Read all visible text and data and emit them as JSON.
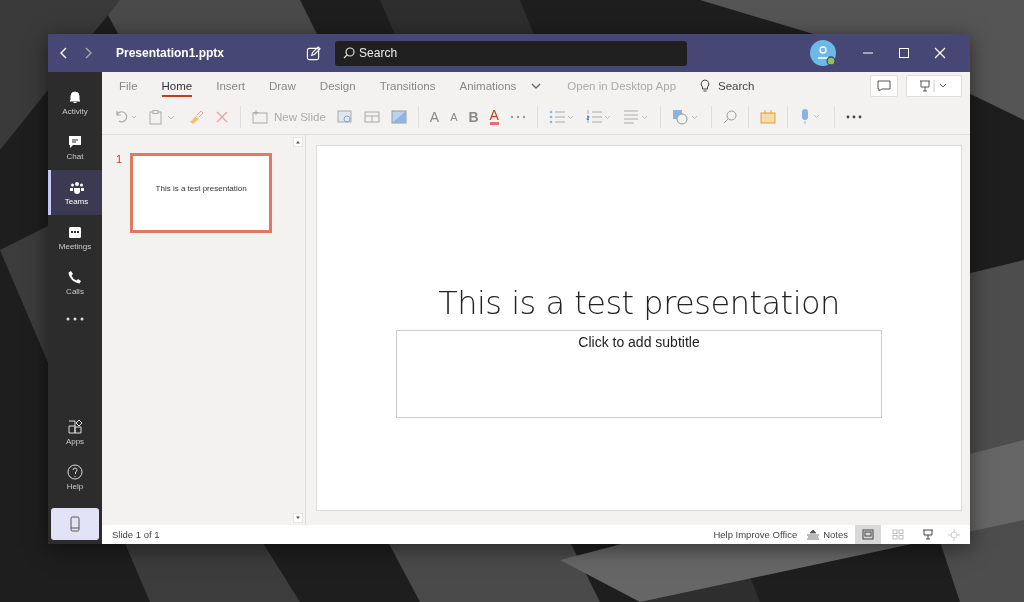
{
  "window": {
    "title": "Presentation1.pptx",
    "search_placeholder": "Search"
  },
  "nav": [
    {
      "label": "Activity",
      "selected": false
    },
    {
      "label": "Chat",
      "selected": false
    },
    {
      "label": "Teams",
      "selected": true
    },
    {
      "label": "Meetings",
      "selected": false
    },
    {
      "label": "Calls",
      "selected": false
    }
  ],
  "nav_bottom": [
    {
      "label": "Apps"
    },
    {
      "label": "Help"
    }
  ],
  "ribbon_tabs": [
    {
      "label": "File",
      "selected": false
    },
    {
      "label": "Home",
      "selected": true
    },
    {
      "label": "Insert",
      "selected": false
    },
    {
      "label": "Draw",
      "selected": false
    },
    {
      "label": "Design",
      "selected": false
    },
    {
      "label": "Transitions",
      "selected": false
    },
    {
      "label": "Animations",
      "selected": false
    }
  ],
  "open_in_desktop": "Open in Desktop App",
  "ribbon_search": "Search",
  "toolbar": {
    "new_slide": "New Slide",
    "grow_font": "A",
    "shrink_font": "A",
    "bold": "B",
    "font_color": "A"
  },
  "slides": [
    {
      "number": "1",
      "title": "This is a test presentation",
      "selected": true
    }
  ],
  "slide": {
    "title": "This is a test presentation",
    "subtitle_placeholder": "Click to add subtitle"
  },
  "status_bar": {
    "position": "Slide 1 of 1",
    "feedback": "Help Improve Office",
    "notes": "Notes",
    "views": [
      {
        "selected": true
      },
      {
        "selected": false
      },
      {
        "selected": false
      }
    ]
  }
}
